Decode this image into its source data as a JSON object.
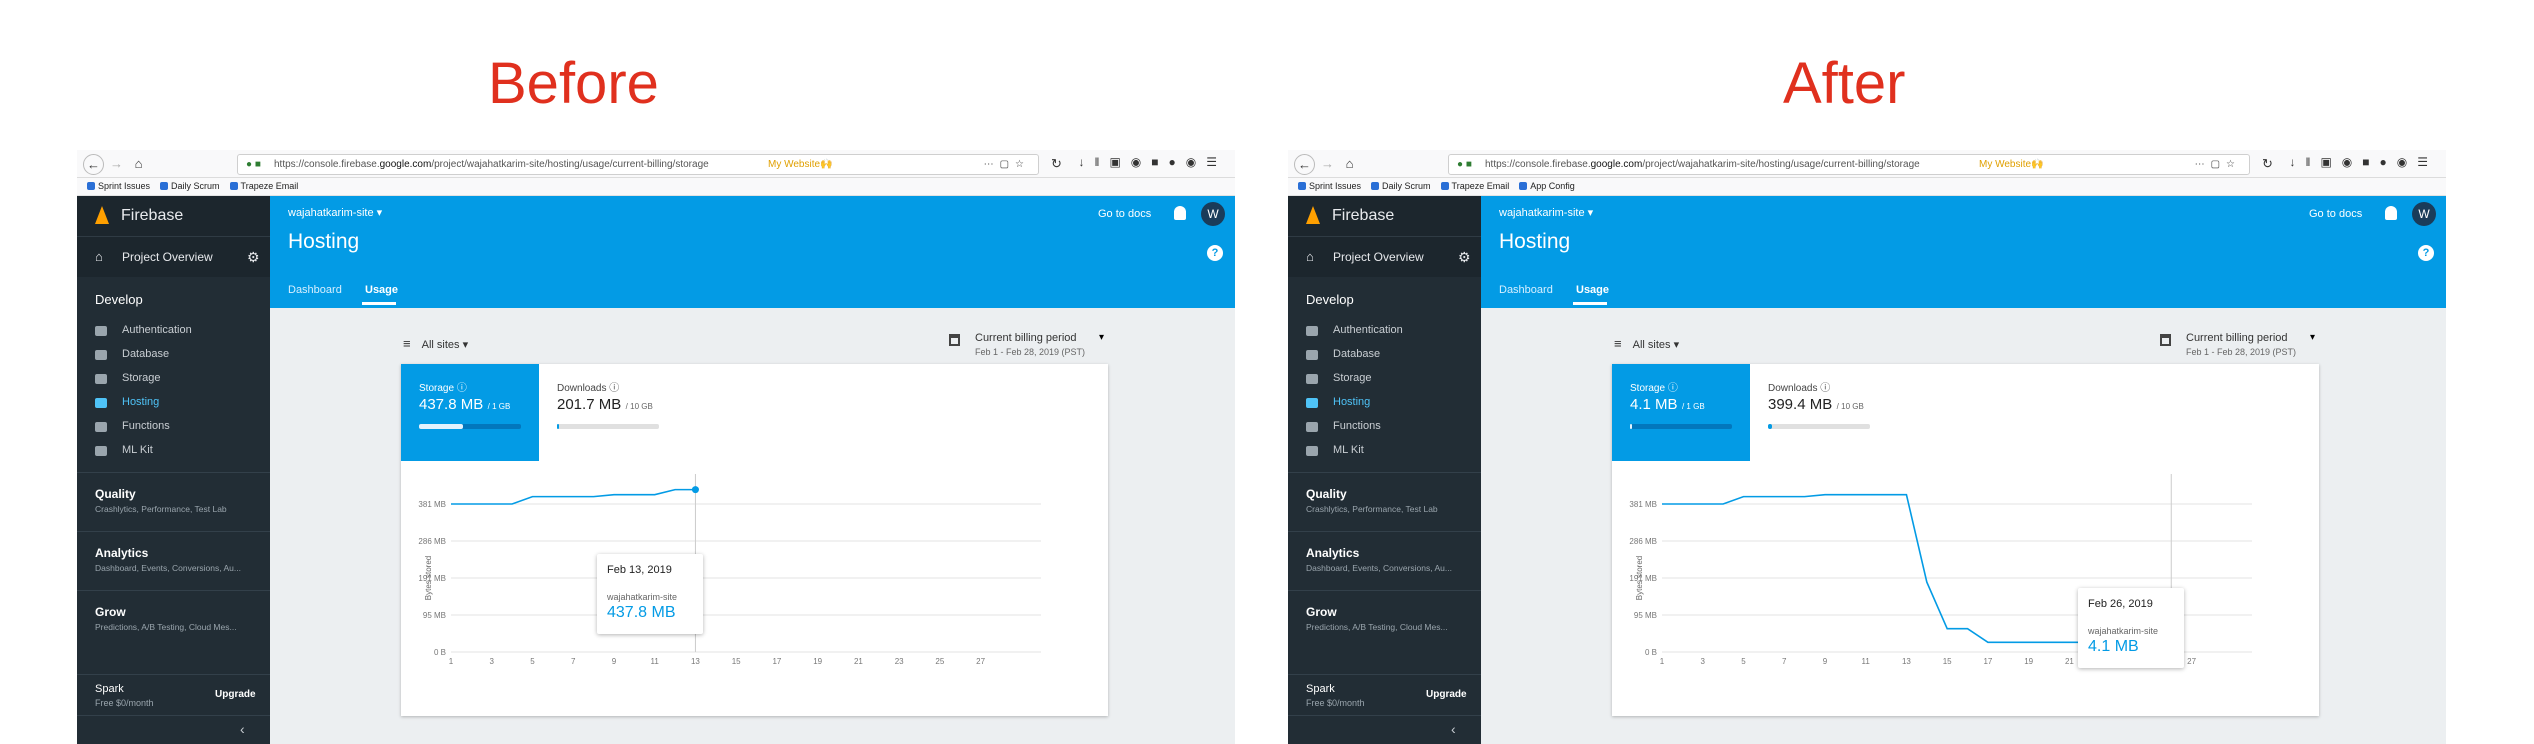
{
  "headings": {
    "before": "Before",
    "after": "After"
  },
  "browser": {
    "url_prefix": "https://console.firebase.",
    "url_domain": "google.com",
    "url_path": "/project/wajahatkarim-site/hosting/usage/current-billing/storage",
    "bookmark_label": "My Website🙌",
    "bookmarks_before": [
      "Sprint Issues",
      "Daily Scrum",
      "Trapeze Email"
    ],
    "bookmarks_after": [
      "Sprint Issues",
      "Daily Scrum",
      "Trapeze Email",
      "App Config"
    ]
  },
  "sidebar": {
    "brand": "Firebase",
    "project_overview": "Project Overview",
    "develop": "Develop",
    "items": [
      "Authentication",
      "Database",
      "Storage",
      "Hosting",
      "Functions",
      "ML Kit"
    ],
    "active_item": "Hosting",
    "groups": [
      {
        "title": "Quality",
        "subtitle": "Crashlytics, Performance, Test Lab"
      },
      {
        "title": "Analytics",
        "subtitle": "Dashboard, Events, Conversions, Au..."
      },
      {
        "title": "Grow",
        "subtitle": "Predictions, A/B Testing, Cloud Mes..."
      }
    ],
    "plan": "Spark",
    "plan_price": "Free $0/month",
    "upgrade": "Upgrade"
  },
  "header": {
    "site_selector": "wajahatkarim-site",
    "title": "Hosting",
    "tabs": [
      "Dashboard",
      "Usage"
    ],
    "active_tab": "Usage",
    "go_to_docs": "Go to docs",
    "avatar": "W",
    "help": "?"
  },
  "filters": {
    "sites": "All sites",
    "period_title": "Current billing period",
    "period_range": "Feb 1 - Feb 28, 2019 (PST)"
  },
  "colors": {
    "accent": "#039be5",
    "heading": "#e0301e",
    "sidebar": "#222d35"
  },
  "before": {
    "storage_label": "Storage",
    "storage_value": "437.8 MB",
    "storage_limit": "/ 1 GB",
    "storage_fraction": 0.43,
    "downloads_label": "Downloads",
    "downloads_value": "201.7 MB",
    "downloads_limit": "/ 10 GB",
    "downloads_fraction": 0.02,
    "tooltip": {
      "date": "Feb 13, 2019",
      "site": "wajahatkarim-site",
      "value": "437.8 MB"
    }
  },
  "after": {
    "storage_label": "Storage",
    "storage_value": "4.1 MB",
    "storage_limit": "/ 1 GB",
    "storage_fraction": 0.004,
    "downloads_label": "Downloads",
    "downloads_value": "399.4 MB",
    "downloads_limit": "/ 10 GB",
    "downloads_fraction": 0.04,
    "tooltip": {
      "date": "Feb 26, 2019",
      "site": "wajahatkarim-site",
      "value": "4.1 MB"
    }
  },
  "chart_data": [
    {
      "type": "line",
      "ylabel": "Bytes stored",
      "yticks": [
        "0 B",
        "95 MB",
        "191 MB",
        "286 MB",
        "381 MB"
      ],
      "xticks": [
        "1",
        "3",
        "5",
        "7",
        "9",
        "11",
        "13",
        "15",
        "17",
        "19",
        "21",
        "23",
        "25",
        "27"
      ],
      "x": [
        1,
        2,
        3,
        4,
        5,
        6,
        7,
        8,
        9,
        10,
        11,
        12,
        13
      ],
      "y": [
        381,
        381,
        381,
        381,
        400,
        400,
        400,
        400,
        405,
        405,
        405,
        418,
        418
      ],
      "xlim": [
        1,
        28
      ],
      "ylim": [
        0,
        381
      ]
    },
    {
      "type": "line",
      "ylabel": "Bytes stored",
      "yticks": [
        "0 B",
        "95 MB",
        "191 MB",
        "286 MB",
        "381 MB"
      ],
      "xticks": [
        "1",
        "3",
        "5",
        "7",
        "9",
        "11",
        "13",
        "15",
        "17",
        "19",
        "21",
        "23",
        "25",
        "27"
      ],
      "x": [
        1,
        2,
        3,
        4,
        5,
        6,
        7,
        8,
        9,
        10,
        11,
        12,
        13,
        14,
        15,
        16,
        17,
        18,
        19,
        20,
        21,
        22,
        23,
        24,
        25,
        26
      ],
      "y": [
        381,
        381,
        381,
        381,
        400,
        400,
        400,
        400,
        405,
        405,
        405,
        405,
        405,
        180,
        60,
        60,
        25,
        25,
        25,
        25,
        25,
        25,
        25,
        25,
        25,
        4
      ],
      "xlim": [
        1,
        28
      ],
      "ylim": [
        0,
        381
      ]
    }
  ]
}
